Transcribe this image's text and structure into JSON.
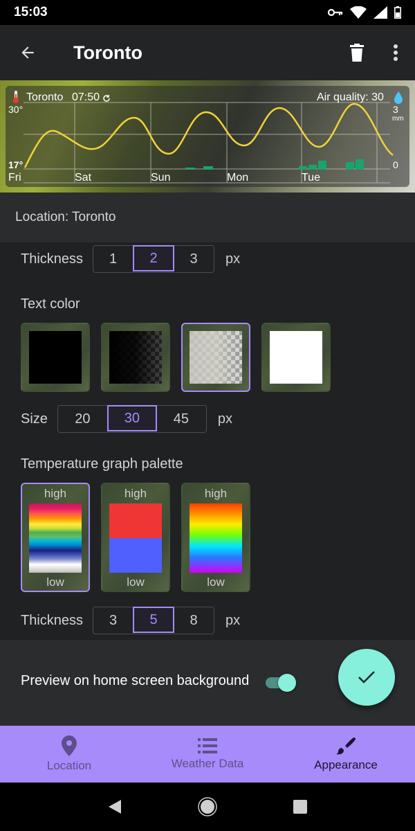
{
  "status_bar": {
    "time": "15:03"
  },
  "app_bar": {
    "title": "Toronto"
  },
  "widget": {
    "location": "Toronto",
    "time": "07:50",
    "air_quality": "Air quality: 30",
    "temp_high": "30°",
    "temp_low": "17°",
    "precip_max": "3",
    "precip_unit": "mm",
    "precip_min": "0",
    "days": [
      "Fri",
      "Sat",
      "Sun",
      "Mon",
      "Tue"
    ]
  },
  "location_label": "Location: Toronto",
  "line_thickness": {
    "label": "Thickness",
    "options": [
      "1",
      "2",
      "3"
    ],
    "selected": "2",
    "unit": "px"
  },
  "text_color": {
    "title": "Text color",
    "selected_index": 2
  },
  "text_size": {
    "label": "Size",
    "options": [
      "20",
      "30",
      "45"
    ],
    "selected": "30",
    "unit": "px"
  },
  "palette": {
    "title": "Temperature graph palette",
    "high_label": "high",
    "low_label": "low",
    "selected_index": 0
  },
  "graph_thickness": {
    "label": "Thickness",
    "options": [
      "3",
      "5",
      "8"
    ],
    "selected": "5",
    "unit": "px"
  },
  "preview": {
    "label": "Preview on home screen background",
    "enabled": true
  },
  "bottom_nav": {
    "items": [
      "Location",
      "Weather Data",
      "Appearance"
    ],
    "active": "Appearance"
  },
  "colors": {
    "accent": "#a78bfa",
    "fab": "#86f0dc",
    "curve": "#f2d23a",
    "precip_bar": "#1aa36f"
  }
}
